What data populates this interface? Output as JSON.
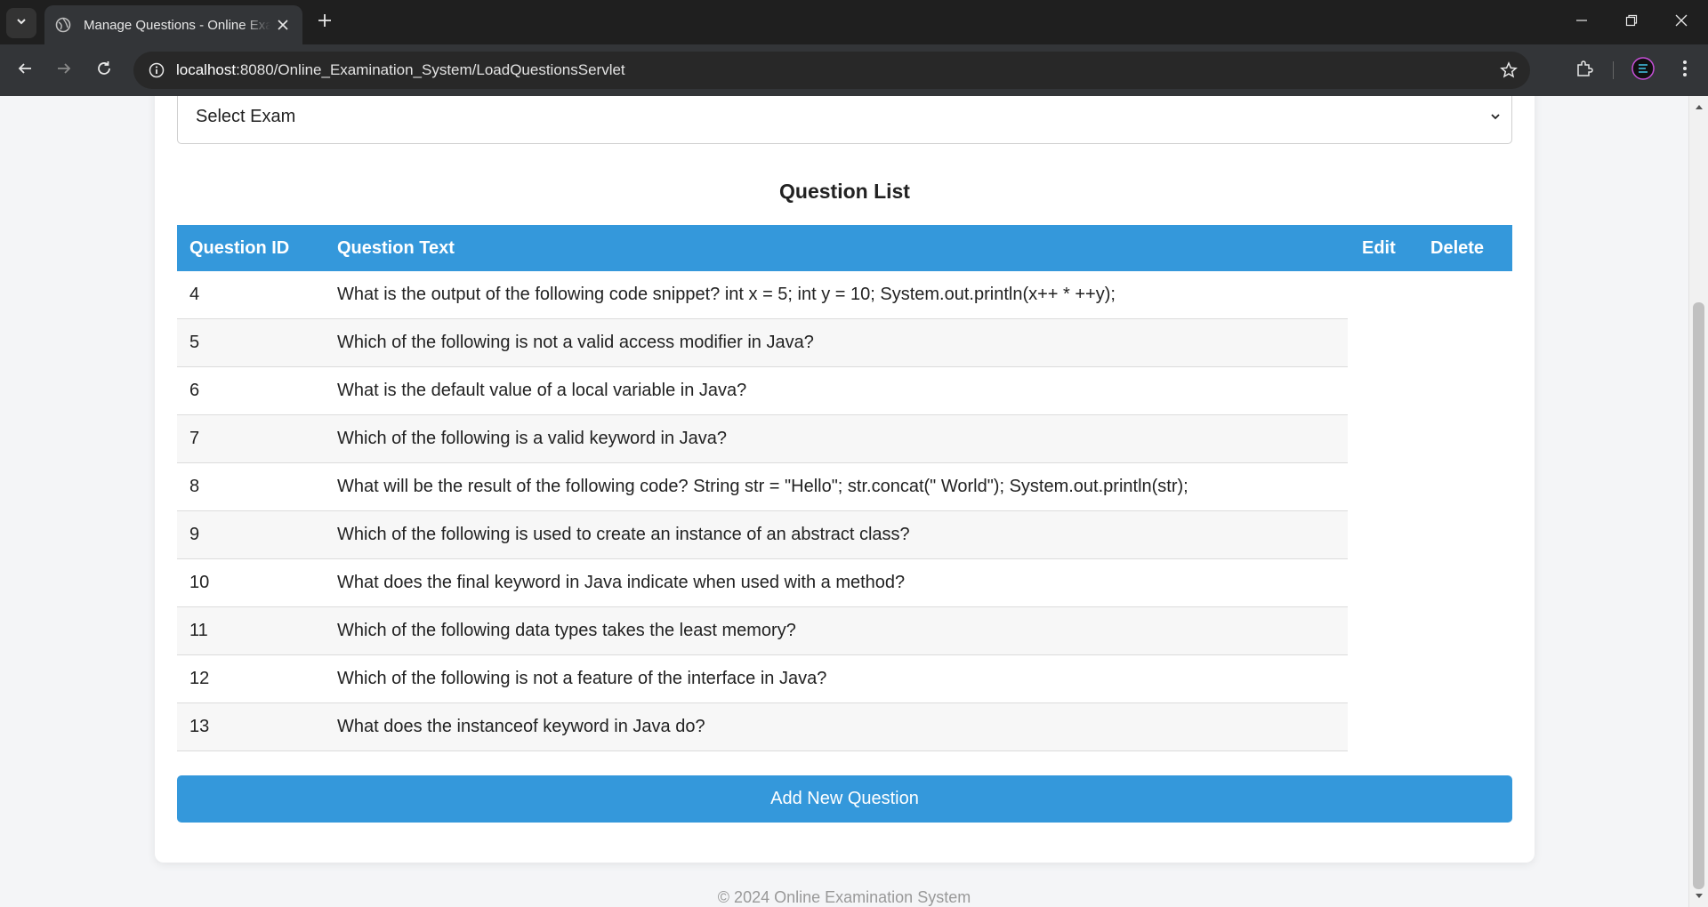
{
  "browser": {
    "tab_title": "Manage Questions - Online Examination System",
    "url_host": "localhost",
    "url_rest": ":8080/Online_Examination_System/LoadQuestionsServlet"
  },
  "page": {
    "exam_select": {
      "selected": "Select Exam"
    },
    "list_title": "Question List",
    "table": {
      "headers": {
        "id": "Question ID",
        "text": "Question Text",
        "edit": "Edit",
        "delete": "Delete"
      },
      "rows": [
        {
          "id": "4",
          "text": "What is the output of the following code snippet? int x = 5; int y = 10; System.out.println(x++ * ++y);"
        },
        {
          "id": "5",
          "text": "Which of the following is not a valid access modifier in Java?"
        },
        {
          "id": "6",
          "text": "What is the default value of a local variable in Java?"
        },
        {
          "id": "7",
          "text": "Which of the following is a valid keyword in Java?"
        },
        {
          "id": "8",
          "text": "What will be the result of the following code? String str = \"Hello\"; str.concat(\" World\"); System.out.println(str);"
        },
        {
          "id": "9",
          "text": "Which of the following is used to create an instance of an abstract class?"
        },
        {
          "id": "10",
          "text": "What does the final keyword in Java indicate when used with a method?"
        },
        {
          "id": "11",
          "text": "Which of the following data types takes the least memory?"
        },
        {
          "id": "12",
          "text": "Which of the following is not a feature of the interface in Java?"
        },
        {
          "id": "13",
          "text": "What does the instanceof keyword in Java do?"
        }
      ]
    },
    "add_button": "Add New Question",
    "footer": "© 2024 Online Examination System"
  },
  "colors": {
    "accent": "#3498db",
    "chrome_dark": "#1f1f1f",
    "chrome_toolbar": "#333538"
  }
}
